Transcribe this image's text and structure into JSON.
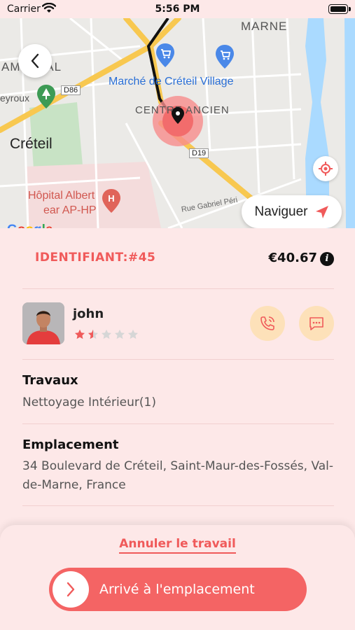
{
  "status_bar": {
    "carrier": "Carrier",
    "time": "5:56 PM"
  },
  "map": {
    "labels": {
      "marne": "MARNE",
      "ampeval": "AMPEVAL",
      "marche": "Marché de Créteil Village",
      "eyroux": "eyroux",
      "d86": "D86",
      "centre": "CENTRE ANCIEN",
      "creteil": "Créteil",
      "d19": "D19",
      "hopital1": "Hôpital Albert",
      "hopital2": "ear AP-HP",
      "rue": "Rue Gabriel Péri"
    },
    "google": "Google",
    "navigate_label": "Naviguer"
  },
  "job": {
    "identifier": "IDENTIFIANT:#45",
    "price": "€40.67"
  },
  "customer": {
    "name": "john",
    "rating": 1.5,
    "rating_max": 5
  },
  "travaux": {
    "title": "Travaux",
    "value": "Nettoyage Intérieur(1)"
  },
  "emplacement": {
    "title": "Emplacement",
    "value": "34 Boulevard de Créteil, Saint-Maur-des-Fossés, Val-de-Marne, France"
  },
  "actions": {
    "cancel_label": "Annuler le travail",
    "arrive_label": "Arrivé à l'emplacement"
  },
  "colors": {
    "accent": "#f05a5a",
    "background": "#fde8e8",
    "action_bg": "#fde1b9",
    "button": "#f46464"
  }
}
